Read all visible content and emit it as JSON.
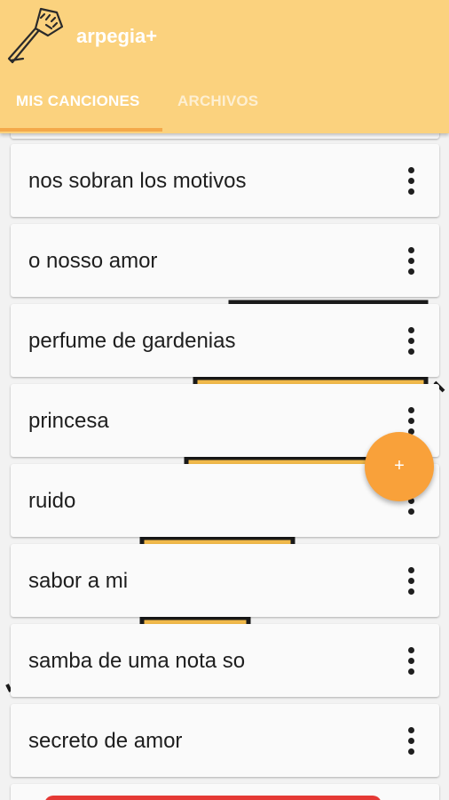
{
  "app": {
    "title": "arpegia+"
  },
  "tabs": [
    {
      "label": "MIS CANCIONES",
      "active": true
    },
    {
      "label": "ARCHIVOS",
      "active": false
    }
  ],
  "songs": [
    {
      "title": "nos sobran los motivos"
    },
    {
      "title": "o nosso amor"
    },
    {
      "title": "perfume de gardenias"
    },
    {
      "title": "princesa"
    },
    {
      "title": "ruido"
    },
    {
      "title": "sabor a mi"
    },
    {
      "title": "samba de uma nota so"
    },
    {
      "title": "secreto de amor"
    }
  ],
  "fab": {
    "label": "+"
  },
  "colors": {
    "appbar": "#fbd27e",
    "tab_indicator": "#f4a94a",
    "fab": "#f9a13a",
    "card": "#fafafa"
  }
}
